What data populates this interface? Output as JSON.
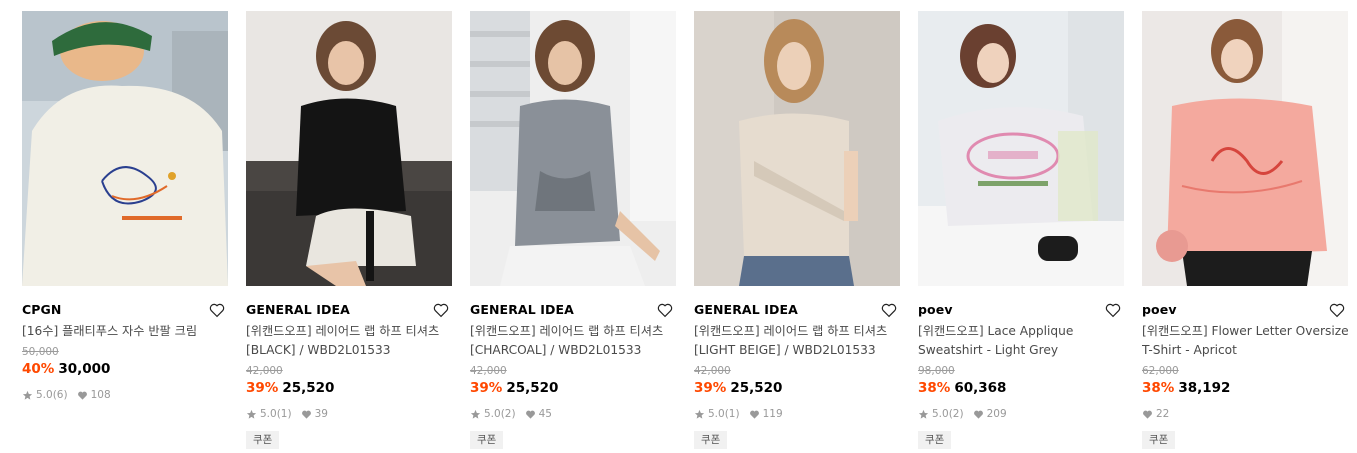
{
  "products": [
    {
      "brand": "CPGN",
      "name_lines": [
        "[16수] 플래티푸스 자수 반팔 크림",
        ""
      ],
      "original_price": "50,000",
      "discount": "40%",
      "price": "30,000",
      "rating": "5.0",
      "reviews": "(6)",
      "likes": "108",
      "coupon": "",
      "image": {
        "bg": "#cdd6dc",
        "garment": "#f1efe6",
        "accent": "#2e6b3c"
      }
    },
    {
      "brand": "GENERAL IDEA",
      "name_lines": [
        "[위캔드오프] 레이어드 랩 하프 티셔츠",
        "[BLACK] / WBD2L01533"
      ],
      "original_price": "42,000",
      "discount": "39%",
      "price": "25,520",
      "rating": "5.0",
      "reviews": "(1)",
      "likes": "39",
      "coupon": "쿠폰",
      "image": {
        "bg": "#e9e6e3",
        "garment": "#141414",
        "accent": "#3a3a3a"
      }
    },
    {
      "brand": "GENERAL IDEA",
      "name_lines": [
        "[위캔드오프] 레이어드 랩 하프 티셔츠",
        "[CHARCOAL] / WBD2L01533"
      ],
      "original_price": "42,000",
      "discount": "39%",
      "price": "25,520",
      "rating": "5.0",
      "reviews": "(2)",
      "likes": "45",
      "coupon": "쿠폰",
      "image": {
        "bg": "#eeeeee",
        "garment": "#8a9098",
        "accent": "#d8d8d8"
      }
    },
    {
      "brand": "GENERAL IDEA",
      "name_lines": [
        "[위캔드오프] 레이어드 랩 하프 티셔츠",
        "[LIGHT BEIGE] / WBD2L01533"
      ],
      "original_price": "42,000",
      "discount": "39%",
      "price": "25,520",
      "rating": "5.0",
      "reviews": "(1)",
      "likes": "119",
      "coupon": "쿠폰",
      "image": {
        "bg": "#d9d3cc",
        "garment": "#e6dccf",
        "accent": "#5a6f8c"
      }
    },
    {
      "brand": "poev",
      "name_lines": [
        "[위캔드오프] Lace Applique",
        "Sweatshirt - Light Grey"
      ],
      "original_price": "98,000",
      "discount": "38%",
      "price": "60,368",
      "rating": "5.0",
      "reviews": "(2)",
      "likes": "209",
      "coupon": "쿠폰",
      "image": {
        "bg": "#e8ecef",
        "garment": "#ecebef",
        "accent": "#e08ab0"
      }
    },
    {
      "brand": "poev",
      "name_lines": [
        "[위캔드오프] Flower Letter Oversized",
        "T-Shirt - Apricot"
      ],
      "original_price": "62,000",
      "discount": "38%",
      "price": "38,192",
      "rating": "",
      "reviews": "",
      "likes": "22",
      "coupon": "쿠폰",
      "image": {
        "bg": "#ece8e6",
        "garment": "#f4a99e",
        "accent": "#d6453d"
      }
    }
  ],
  "colors": {
    "discount": "#ff4800",
    "muted": "#999999",
    "coupon_bg": "#f1f1f1"
  },
  "icons": {
    "heart": "heart-outline-icon",
    "star": "star-icon",
    "like": "heart-filled-icon"
  }
}
